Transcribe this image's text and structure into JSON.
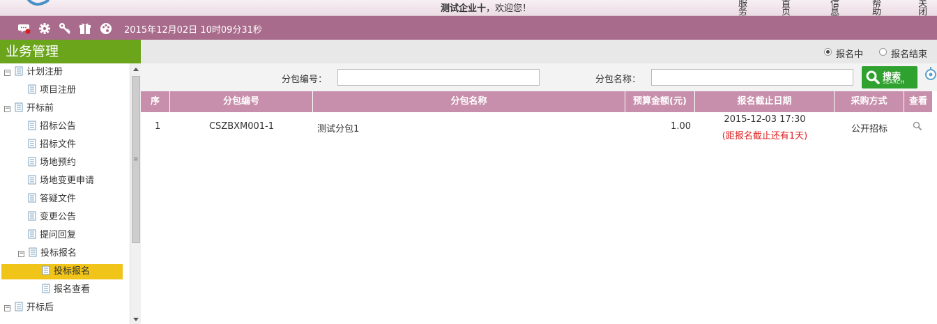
{
  "header": {
    "company": "测试企业十",
    "greeting": "，欢迎您！",
    "nav": [
      "服务大厅",
      "首页",
      "信息网",
      "帮助",
      "关闭"
    ]
  },
  "toolbar": {
    "icons": [
      "message-icon",
      "gear-icon",
      "key-icon",
      "gift-icon",
      "palette-icon"
    ],
    "datetime": "2015年12月02日 10时09分31秒"
  },
  "sidebar": {
    "title": "业务管理",
    "items": [
      {
        "label": "计划注册",
        "level": 0,
        "expanded": true
      },
      {
        "label": "项目注册",
        "level": 1
      },
      {
        "label": "开标前",
        "level": 0,
        "expanded": true
      },
      {
        "label": "招标公告",
        "level": 1
      },
      {
        "label": "招标文件",
        "level": 1
      },
      {
        "label": "场地预约",
        "level": 1
      },
      {
        "label": "场地变更申请",
        "level": 1
      },
      {
        "label": "答疑文件",
        "level": 1
      },
      {
        "label": "变更公告",
        "level": 1
      },
      {
        "label": "提问回复",
        "level": 1
      },
      {
        "label": "投标报名",
        "level": 1,
        "expanded": true
      },
      {
        "label": "投标报名",
        "level": 2,
        "selected": true
      },
      {
        "label": "报名查看",
        "level": 2
      },
      {
        "label": "开标后",
        "level": 0,
        "expanded": true
      }
    ]
  },
  "filter": {
    "options": [
      "报名中",
      "报名结束"
    ],
    "selected": "报名中"
  },
  "search": {
    "package_no_label": "分包编号：",
    "package_no_value": "",
    "package_name_label": "分包名称：",
    "package_name_value": "",
    "button_label": "搜索",
    "button_sub": "SEARCH"
  },
  "table": {
    "columns": [
      "序",
      "分包编号",
      "分包名称",
      "预算金额(元)",
      "报名截止日期",
      "采购方式",
      "查看"
    ],
    "rows": [
      {
        "seq": "1",
        "package_no": "CSZBXM001-1",
        "package_name": "测试分包1",
        "budget": "1.00",
        "deadline": "2015-12-03 17:30",
        "deadline_note": "(距报名截止还有1天)",
        "method": "公开招标",
        "view_icon": "magnifier-icon"
      }
    ]
  },
  "colors": {
    "toolbar": "#a86b8b",
    "table_header": "#c78fab",
    "sidebar_title": "#6ba51c",
    "selected_item": "#f0c419",
    "search_button": "#2fa12f",
    "deadline_note": "#e02020"
  }
}
